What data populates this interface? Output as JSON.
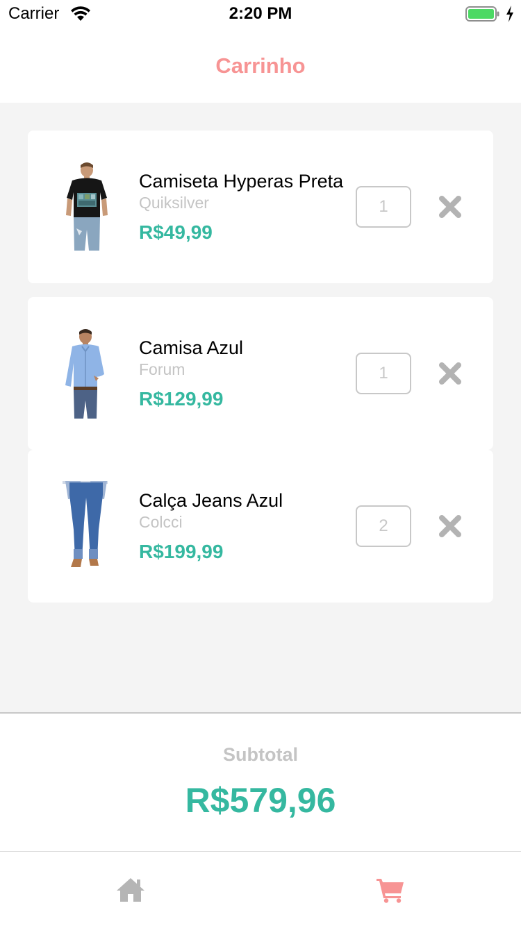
{
  "status_bar": {
    "carrier": "Carrier",
    "time": "2:20 PM",
    "icons": [
      "wifi-icon",
      "battery-icon",
      "charging-bolt-icon"
    ]
  },
  "header": {
    "title": "Carrinho"
  },
  "cart": {
    "items": [
      {
        "name": "Camiseta Hyperas Preta",
        "brand": "Quiksilver",
        "price": "R$49,99",
        "quantity": "1",
        "image": "black-tshirt-model"
      },
      {
        "name": "Camisa Azul",
        "brand": "Forum",
        "price": "R$129,99",
        "quantity": "1",
        "image": "blue-shirt-model"
      },
      {
        "name": "Calça Jeans Azul",
        "brand": "Colcci",
        "price": "R$199,99",
        "quantity": "2",
        "image": "blue-jeans-model"
      }
    ],
    "remove_icon": "close-icon"
  },
  "subtotal": {
    "label": "Subtotal",
    "value": "R$579,96"
  },
  "tab_bar": {
    "tabs": [
      {
        "icon": "home-icon",
        "active": false
      },
      {
        "icon": "cart-icon",
        "active": true
      }
    ]
  },
  "colors": {
    "title": "#f79494",
    "price": "#35b8a0",
    "muted": "#c4c4c4",
    "background": "#f4f4f4",
    "tab_active": "#f79494",
    "tab_inactive": "#b5b5b5",
    "battery": "#4cd964"
  }
}
